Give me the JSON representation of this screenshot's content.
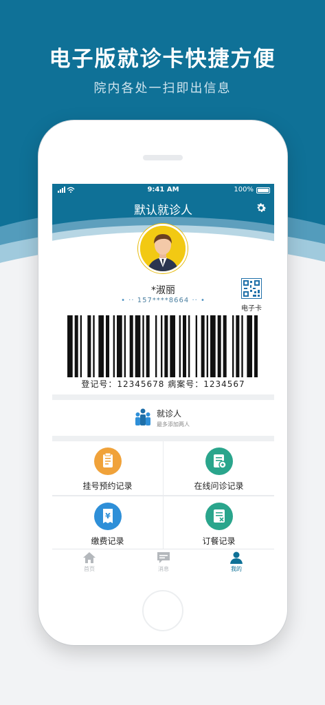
{
  "promo": {
    "headline": "电子版就诊卡快捷方便",
    "subline": "院内各处一扫即出信息"
  },
  "status_bar": {
    "time": "9:41 AM",
    "battery": "100%"
  },
  "header": {
    "title": "默认就诊人",
    "settings_icon": "gear-icon"
  },
  "patient": {
    "name": "*淑丽",
    "phone": "157****8664",
    "qr_label": "电子卡",
    "registration_text": "登记号：12345678   病案号：1234567"
  },
  "visitor": {
    "title": "就诊人",
    "subtitle": "最多添加两人"
  },
  "services": [
    {
      "label": "挂号预约记录",
      "icon": "clipboard-icon",
      "color": "#f0a23a"
    },
    {
      "label": "在线问诊记录",
      "icon": "medical-chat-icon",
      "color": "#2aa58c"
    },
    {
      "label": "缴费记录",
      "icon": "receipt-icon",
      "color": "#2e8fd8"
    },
    {
      "label": "订餐记录",
      "icon": "meal-order-icon",
      "color": "#2aa58c"
    }
  ],
  "tabs": [
    {
      "label": "首页",
      "icon": "home-icon"
    },
    {
      "label": "消息",
      "icon": "message-icon"
    },
    {
      "label": "我的",
      "icon": "user-icon"
    }
  ],
  "colors": {
    "brand": "#0f7197",
    "active_tab": "#0f7197"
  }
}
